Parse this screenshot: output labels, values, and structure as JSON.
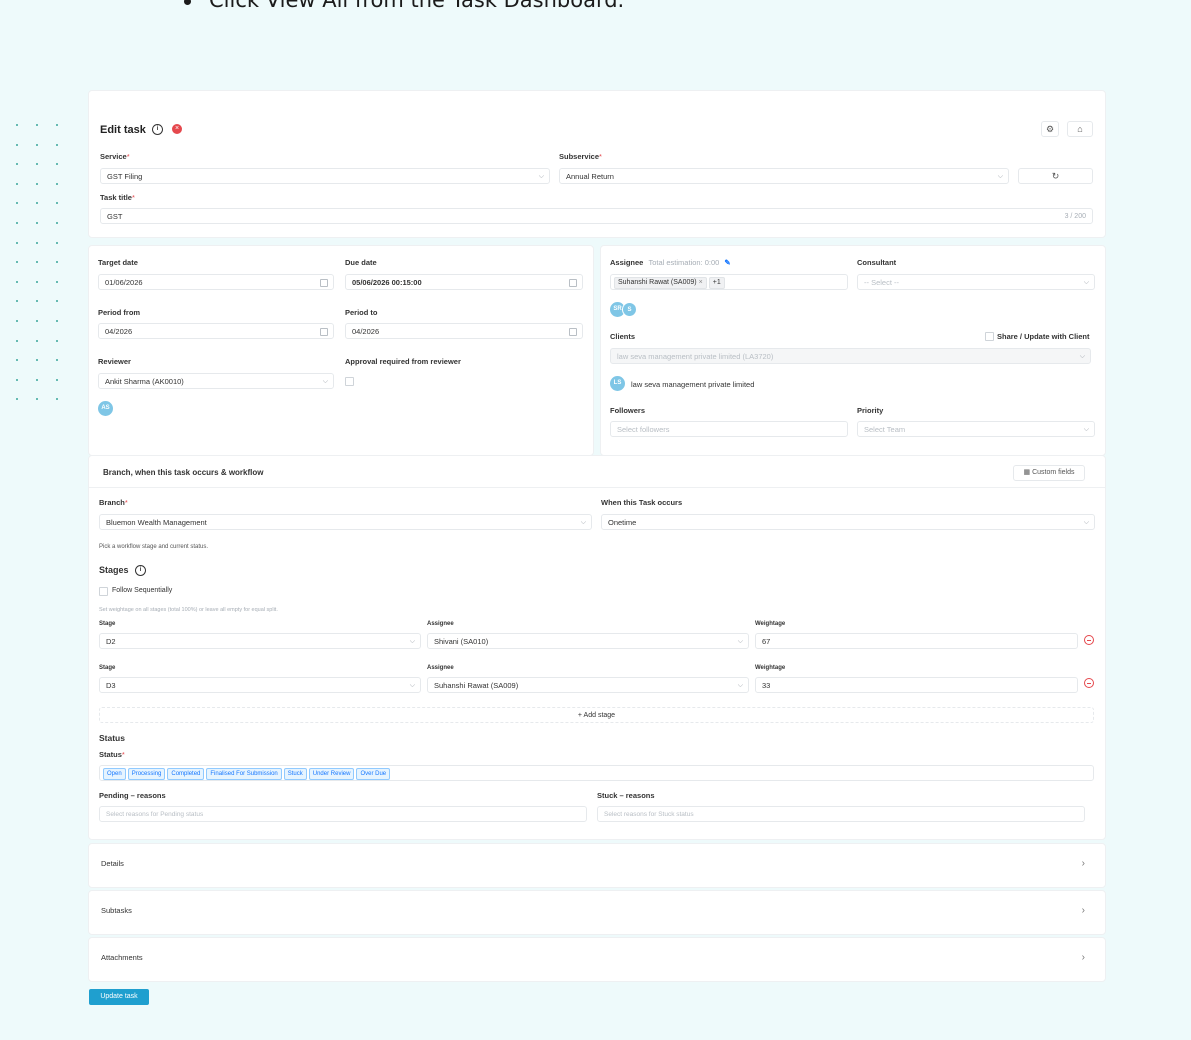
{
  "instruction": "Click View All from the Task Dashboard.",
  "header": {
    "title": "Edit task"
  },
  "service": {
    "label": "Service",
    "value": "GST Filing"
  },
  "subservice": {
    "label": "Subservice",
    "value": "Annual Return"
  },
  "task_title": {
    "label": "Task title",
    "value": "GST",
    "counter": "3 / 200"
  },
  "target_date": {
    "label": "Target date",
    "value": "01/06/2026"
  },
  "due_date": {
    "label": "Due date",
    "value": "05/06/2026 00:15:00"
  },
  "period_from": {
    "label": "Period from",
    "value": "04/2026"
  },
  "period_to": {
    "label": "Period to",
    "value": "04/2026"
  },
  "reviewer": {
    "label": "Reviewer",
    "value": "Ankit Sharma (AK0010)",
    "avatar": "AS"
  },
  "approval": {
    "label": "Approval required from reviewer"
  },
  "assignee": {
    "label": "Assignee",
    "estimation": "Total estimation: 0:00",
    "tag": "Suhanshi Rawat (SA009)",
    "more": "+1",
    "avatars": [
      "SR",
      "S"
    ]
  },
  "consultant": {
    "label": "Consultant",
    "placeholder": "-- Select --"
  },
  "clients": {
    "label": "Clients",
    "share_label": "Share / Update with Client",
    "placeholder": "law seva management private limited (LA3720)",
    "avatar": "LS",
    "selected": "law seva management private limited"
  },
  "followers": {
    "label": "Followers",
    "placeholder": "Select followers"
  },
  "priority": {
    "label": "Priority",
    "placeholder": "Select Team"
  },
  "workflow": {
    "title": "Branch, when this task occurs & workflow",
    "custom_fields": "Custom fields",
    "branch_label": "Branch",
    "branch_value": "Bluemon Wealth Management",
    "occurs_label": "When this Task occurs",
    "occurs_value": "Onetime",
    "hint": "Pick a workflow stage and current status.",
    "stages_label": "Stages",
    "follow_seq": "Follow Sequentially",
    "weight_hint": "Set weightage on all stages (total 100%) or leave all empty for equal split.",
    "col_stage": "Stage",
    "col_assignee": "Assignee",
    "col_weightage": "Weightage",
    "stages": [
      {
        "stage": "D2",
        "assignee": "Shivani (SA010)",
        "weight": "67"
      },
      {
        "stage": "D3",
        "assignee": "Suhanshi Rawat (SA009)",
        "weight": "33"
      }
    ],
    "add_stage": "+ Add stage",
    "status_heading": "Status",
    "status_label": "Status",
    "statuses": [
      "Open",
      "Processing",
      "Completed",
      "Finalised For Submission",
      "Stuck",
      "Under Review",
      "Over Due"
    ],
    "pending_label": "Pending – reasons",
    "pending_placeholder": "Select reasons for Pending status",
    "stuck_label": "Stuck – reasons",
    "stuck_placeholder": "Select reasons for Stuck status"
  },
  "sections": {
    "details": "Details",
    "subtasks": "Subtasks",
    "attachments": "Attachments"
  },
  "update_button": "Update task"
}
